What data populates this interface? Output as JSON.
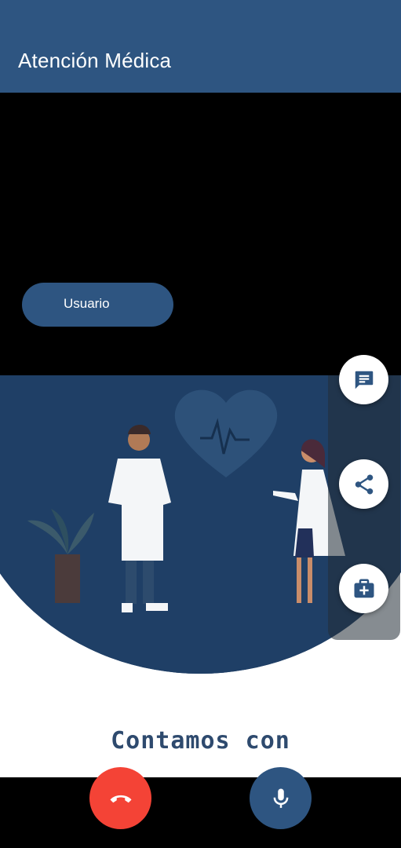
{
  "app_bar": {
    "title": "Atención Médica"
  },
  "remote_video": {
    "user_label": "Usuario"
  },
  "local_video": {
    "headline": "Contamos con"
  },
  "side_actions": [
    {
      "icon": "chat-icon"
    },
    {
      "icon": "share-icon"
    },
    {
      "icon": "medical-kit-icon"
    }
  ],
  "call_controls": [
    {
      "icon": "end-call-icon",
      "color": "#f44336"
    },
    {
      "icon": "microphone-icon",
      "color": "#2e5581"
    }
  ],
  "colors": {
    "primary": "#2e5581",
    "danger": "#f44336",
    "illustration_bg": "#1f3f66"
  }
}
